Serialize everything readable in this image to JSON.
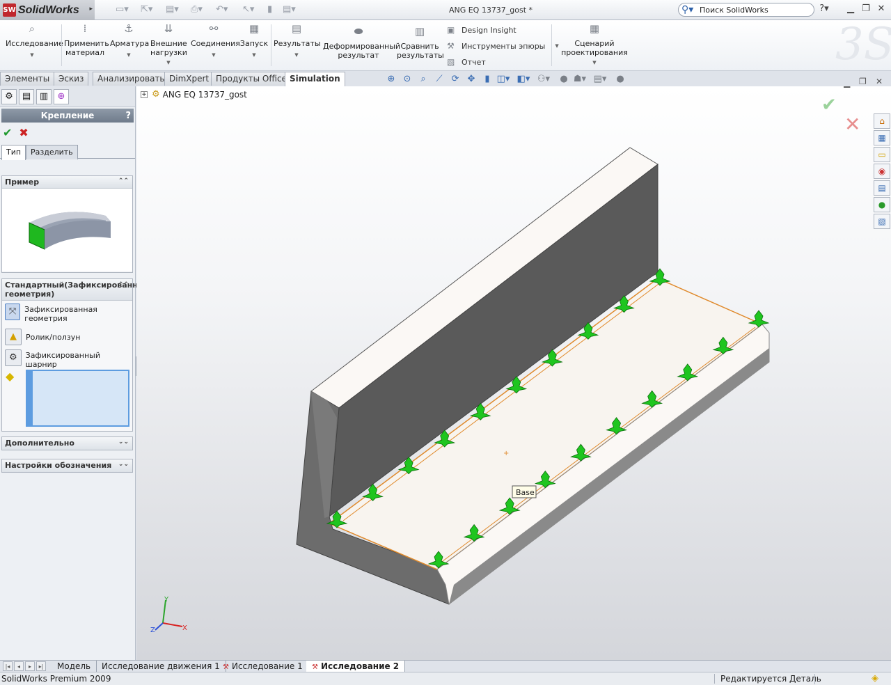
{
  "app": {
    "name": "SolidWorks",
    "badge": "SW",
    "document_title": "ANG EQ 13737_gost *",
    "search_placeholder": "Поиск SolidWorks"
  },
  "ribbon": {
    "buttons": [
      {
        "label": "Исследование"
      },
      {
        "label": "Применить\nматериал"
      },
      {
        "label": "Арматура"
      },
      {
        "label": "Внешние\nнагрузки"
      },
      {
        "label": "Соединения"
      },
      {
        "label": "Запуск"
      },
      {
        "label": "Результаты"
      },
      {
        "label": "Деформированный\nрезультат"
      },
      {
        "label": "Сравнить\nрезультаты"
      },
      {
        "label": "Сценарий\nпроектирования"
      }
    ],
    "small": [
      "Design Insight",
      "Инструменты эпюры",
      "Отчет"
    ]
  },
  "command_tabs": [
    {
      "label": "Элементы"
    },
    {
      "label": "Эскиз"
    },
    {
      "label": "Анализировать"
    },
    {
      "label": "DimXpert"
    },
    {
      "label": "Продукты Office"
    },
    {
      "label": "Simulation",
      "active": true
    }
  ],
  "property_manager": {
    "title": "Крепление",
    "help": "?",
    "tabs": [
      "Тип",
      "Разделить"
    ],
    "example_group": "Пример",
    "standard_group": "Стандартный(Зафиксированна геометрия)",
    "options": [
      "Зафиксированная геометрия",
      "Ролик/ползун",
      "Зафиксированный шарнир"
    ],
    "advanced": "Дополнительно",
    "symbol_settings": "Настройки обозначения"
  },
  "tree": {
    "root": "ANG EQ 13737_gost"
  },
  "viewport": {
    "face_tooltip": "Base",
    "triad": {
      "x": "X",
      "y": "Y",
      "z": "Z"
    },
    "colors": {
      "model_face": "#f8f4ef",
      "model_dark": "#5a5a5a",
      "fixture_arrow": "#1fc51f",
      "edge_highlight": "#e08a2c"
    }
  },
  "bottom_tabs": [
    {
      "label": "Модель"
    },
    {
      "label": "Исследование движения 1"
    },
    {
      "label": "Исследование 1"
    },
    {
      "label": "Исследование 2",
      "active": true
    }
  ],
  "status": {
    "left": "SolidWorks Premium 2009",
    "right": "Редактируется Деталь"
  }
}
